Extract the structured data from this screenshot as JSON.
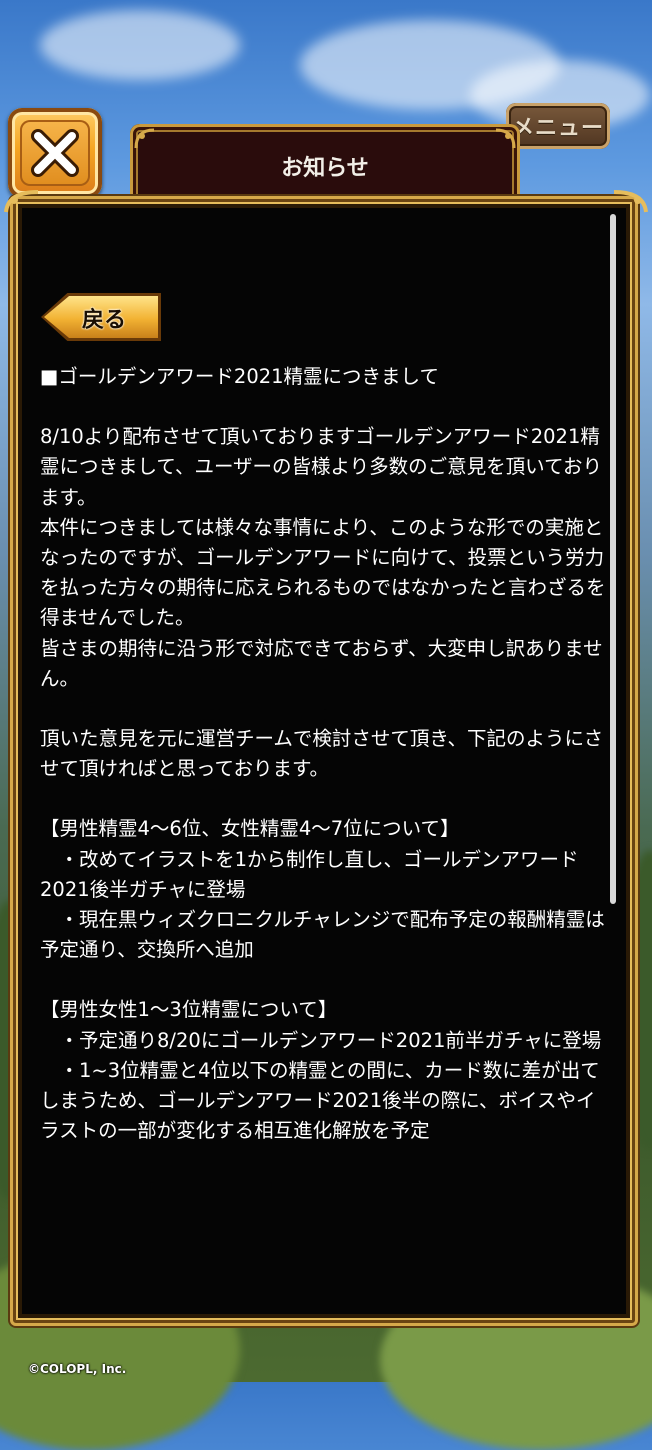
{
  "header": {
    "title": "お知らせ",
    "menu_label": "メニュー"
  },
  "back_label": "戻る",
  "article": {
    "heading": "■ゴールデンアワード2021精霊につきまして",
    "p1": "8/10より配布させて頂いておりますゴールデンアワード2021精霊につきまして、ユーザーの皆様より多数のご意見を頂いております。\n本件につきましては様々な事情により、このような形での実施となったのですが、ゴールデンアワードに向けて、投票という労力を払った方々の期待に応えられるものではなかったと言わざるを得ませんでした。\n皆さまの期待に沿う形で対応できておらず、大変申し訳ありません。",
    "p2": "頂いた意見を元に運営チームで検討させて頂き、下記のようにさせて頂ければと思っております。",
    "section1_title": "【男性精霊4～6位、女性精霊4～7位について】",
    "section1_items": [
      "　・改めてイラストを1から制作し直し、ゴールデンアワード2021後半ガチャに登場",
      "　・現在黒ウィズクロニクルチャレンジで配布予定の報酬精霊は予定通り、交換所へ追加"
    ],
    "section2_title": "【男性女性1～3位精霊について】",
    "section2_items": [
      "　・予定通り8/20にゴールデンアワード2021前半ガチャに登場",
      "　・1~3位精霊と4位以下の精霊との間に、カード数に差が出てしまうため、ゴールデンアワード2021後半の際に、ボイスやイラストの一部が変化する相互進化解放を予定"
    ]
  },
  "copyright": "©COLOPL, Inc.",
  "colors": {
    "panel_bg": "#050505",
    "gold_frame": "#d6a94a",
    "close_button": "#f5a623"
  },
  "icons": {
    "close": "close-x-icon",
    "back": "back-arrow-icon"
  }
}
